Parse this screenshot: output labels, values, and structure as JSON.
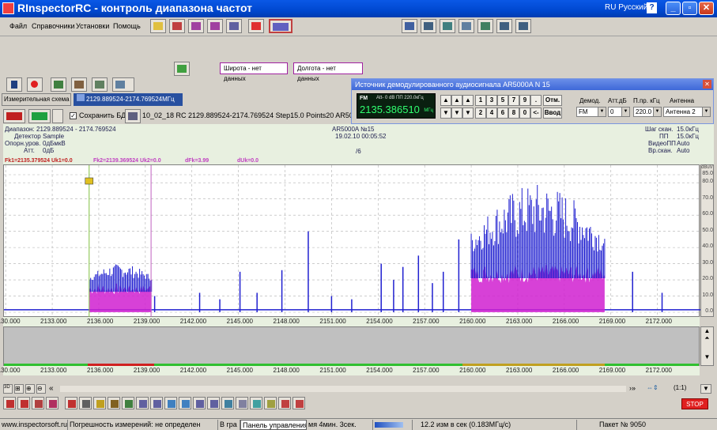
{
  "window": {
    "title": "RInspectorRC - контроль диапазона частот",
    "language": "RU Русский"
  },
  "menu": [
    "Файл",
    "Справочники",
    "Установки",
    "Помощь"
  ],
  "coords": {
    "lat": "Широта - нет данных",
    "lon": "Долгота - нет данных"
  },
  "tabs": {
    "scheme": "Измерительная схема",
    "range": "2129.889524-2174.769524МГц"
  },
  "filebar": {
    "save_db": "Сохранить БД",
    "file": "10_02_18 RC 2129.889524-2174.769524 Step15.0 Points20 AR5000A 0.pan"
  },
  "demod": {
    "title": "Источник демодулированного аудиосигнала AR5000A N 15",
    "lcd_mode": "FM",
    "lcd_att": "Att- 0 dB  ПП 220.0кГц",
    "lcd_freq": "2135.386510",
    "lcd_unit": "МГц",
    "keys_top": [
      "1",
      "3",
      "5",
      "7",
      "9",
      "."
    ],
    "keys_bottom": [
      "2",
      "4",
      "6",
      "8",
      "0",
      "<-"
    ],
    "btn_cancel": "Отм.",
    "btn_enter": "Ввод",
    "labels": {
      "demod": "Демод.",
      "att": "Атт.дБ",
      "bw": "П.пр. кГц",
      "ant": "Антенна"
    },
    "values": {
      "demod": "FM",
      "att": "0",
      "bw": "220.0",
      "ant": "Антенна 2"
    }
  },
  "info": {
    "range_label": "Диапазон:",
    "range": "2129.889524 - 2174.769524",
    "detector_label": "Детектор",
    "detector": "Sample",
    "ref_label": "Опорн.уров.",
    "ref": "0дБмкВ",
    "att_label": "Атт.",
    "att": "0дБ",
    "device": "AR5000A №15",
    "datetime": "19.02.10 00:05:52",
    "counter": "/6",
    "step_label": "Шаг скан.",
    "step": "15.0кГц",
    "pp_label": "ПП",
    "pp": "15.0кГц",
    "video_label": "ВидеоПП",
    "video": "Auto",
    "scan_label": "Вр.скан.",
    "scan": "Auto",
    "markers": [
      "Fk1=2135.379524  Uk1=0.0",
      "Fk2=2139.369524  Uk2=0.0",
      "dFk=3.99",
      "dUk=0.0"
    ]
  },
  "chart_data": {
    "type": "area",
    "xlim": [
      2129.889524,
      2174.769524
    ],
    "ylim": [
      0,
      85
    ],
    "ylabel": "dBuV",
    "x_ticks": [
      "2130.000",
      "2133.000",
      "2136.000",
      "2139.000",
      "2142.000",
      "2145.000",
      "2148.000",
      "2151.000",
      "2154.000",
      "2157.000",
      "2160.000",
      "2163.000",
      "2166.000",
      "2169.000",
      "2172.000"
    ],
    "y_ticks": [
      "85.0",
      "80.0",
      "70.0",
      "60.0",
      "50.0",
      "40.0",
      "30.0",
      "20.0",
      "10.0",
      "0.0"
    ],
    "bands": [
      {
        "x": [
          2135.4,
          2139.4
        ],
        "peak": 30,
        "fill": 18
      },
      {
        "x": [
          2160.0,
          2168.6
        ],
        "peak": 80,
        "fill": 30
      }
    ],
    "spikes": [
      {
        "x": 2139.6,
        "y": 10
      },
      {
        "x": 2142.5,
        "y": 12
      },
      {
        "x": 2143.8,
        "y": 8
      },
      {
        "x": 2145.1,
        "y": 25
      },
      {
        "x": 2146.2,
        "y": 12
      },
      {
        "x": 2147.8,
        "y": 26
      },
      {
        "x": 2149.5,
        "y": 50
      },
      {
        "x": 2151.0,
        "y": 10
      },
      {
        "x": 2152.3,
        "y": 8
      },
      {
        "x": 2154.2,
        "y": 30
      },
      {
        "x": 2155.0,
        "y": 20
      },
      {
        "x": 2155.6,
        "y": 28
      },
      {
        "x": 2156.6,
        "y": 35
      },
      {
        "x": 2157.5,
        "y": 18
      },
      {
        "x": 2158.2,
        "y": 25
      },
      {
        "x": 2159.2,
        "y": 45
      },
      {
        "x": 2170.4,
        "y": 25
      },
      {
        "x": 2172.3,
        "y": 12
      }
    ],
    "colors": {
      "trace": "#2020d0",
      "fill": "#d020d0",
      "marker1": "#80c040",
      "marker2": "#c060c0"
    }
  },
  "status": {
    "url": "www.inspectorsoft.ru",
    "error": "Погрешность измерений: не определен",
    "mode": "В гра",
    "panel": "Панель управления",
    "time": "мя 4мин. 3сек.",
    "rate": "12.2 изм в сек (0.183МГц/с)",
    "packet": "Пакет № 9050"
  },
  "buttons": {
    "stop": "STOP",
    "ratio": "(1:1)"
  }
}
